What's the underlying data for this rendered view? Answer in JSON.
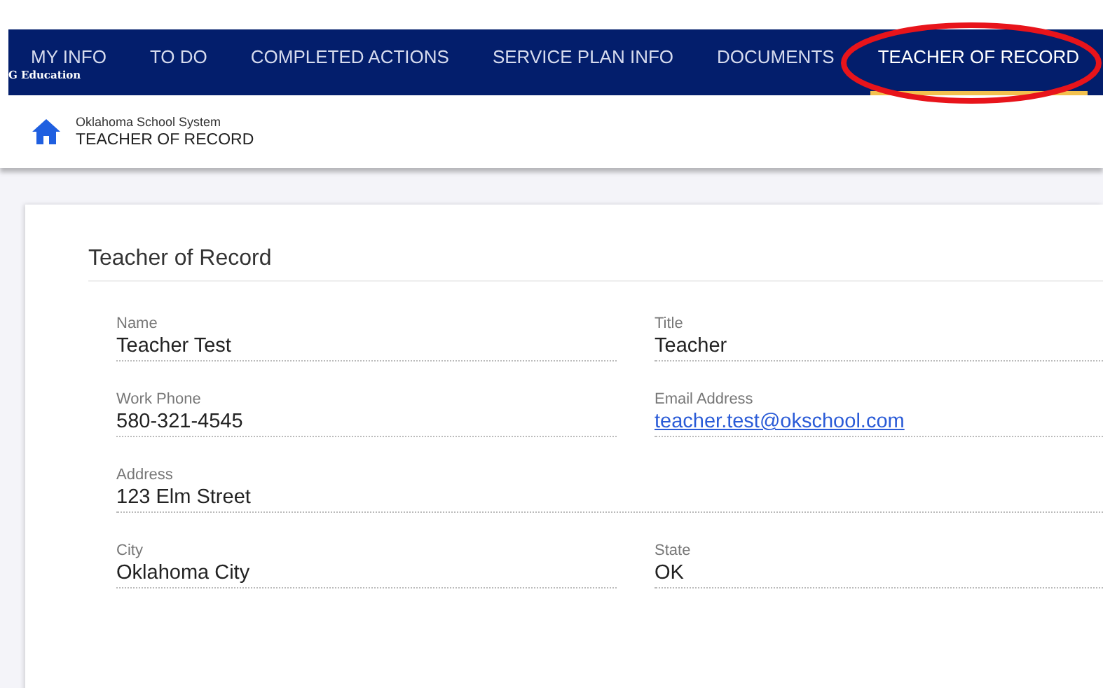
{
  "nav": {
    "tabs": [
      {
        "label": "MY INFO",
        "selected": false
      },
      {
        "label": "TO DO",
        "selected": false
      },
      {
        "label": "COMPLETED ACTIONS",
        "selected": false
      },
      {
        "label": "SERVICE PLAN INFO",
        "selected": false
      },
      {
        "label": "DOCUMENTS",
        "selected": false
      },
      {
        "label": "TEACHER OF RECORD",
        "selected": true
      }
    ],
    "overlay_text": "G Education"
  },
  "breadcrumb": {
    "parent": "Oklahoma School System",
    "current": "TEACHER OF RECORD"
  },
  "card": {
    "title": "Teacher of Record",
    "rows": [
      [
        {
          "label": "Name",
          "value": "Teacher Test",
          "kind": "text"
        },
        {
          "label": "Title",
          "value": "Teacher",
          "kind": "text"
        }
      ],
      [
        {
          "label": "Work Phone",
          "value": "580-321-4545",
          "kind": "text"
        },
        {
          "label": "Email Address",
          "value": "teacher.test@okschool.com",
          "kind": "link"
        }
      ],
      [
        {
          "label": "Address",
          "value": "123 Elm Street",
          "kind": "text"
        }
      ],
      [
        {
          "label": "City",
          "value": "Oklahoma City",
          "kind": "text"
        },
        {
          "label": "State",
          "value": "OK",
          "kind": "text"
        }
      ]
    ]
  }
}
